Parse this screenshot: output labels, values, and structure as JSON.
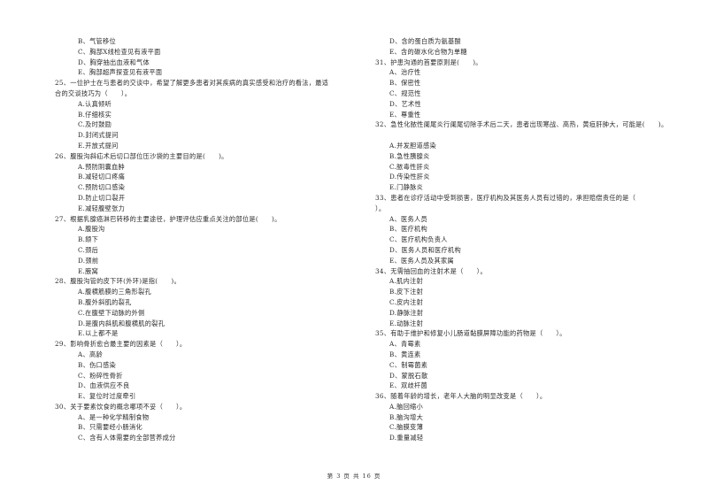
{
  "left_column": [
    {
      "type": "opt",
      "text": "B、气管移位"
    },
    {
      "type": "opt",
      "text": "C、胸部X线检查见有液平面"
    },
    {
      "type": "opt",
      "text": "D、胸穿抽出血液和气体"
    },
    {
      "type": "opt",
      "text": "E、胸部超声探查见有液平面"
    },
    {
      "type": "q",
      "text": "25、一位护士在与患者的交谈中，希望了解更多患者对其疾病的真实感受和治疗的看法，最适"
    },
    {
      "type": "cont",
      "text": "合的交谈技巧为（　　）。"
    },
    {
      "type": "opt",
      "text": "A.认真倾听"
    },
    {
      "type": "opt",
      "text": "B.仔细核实"
    },
    {
      "type": "opt",
      "text": "C.及时鼓励"
    },
    {
      "type": "opt",
      "text": "D.封闭式提问"
    },
    {
      "type": "opt",
      "text": "E.开放式提问"
    },
    {
      "type": "q",
      "text": "26、腹股沟斜疝术后切口部位压沙袋的主要目的是(　　)。"
    },
    {
      "type": "opt",
      "text": "A.预防阴囊血肿"
    },
    {
      "type": "opt",
      "text": "B.减轻切口疼痛"
    },
    {
      "type": "opt",
      "text": "C.预防切口感染"
    },
    {
      "type": "opt",
      "text": "D.防止切口裂开"
    },
    {
      "type": "opt",
      "text": "E.减轻腹壁张力"
    },
    {
      "type": "q",
      "text": "27、根据乳腺癌淋巴转移的主要途径，护理评估应重点关注的部位是(　　)。"
    },
    {
      "type": "opt",
      "text": "A.腹股沟"
    },
    {
      "type": "opt",
      "text": "B.颌下"
    },
    {
      "type": "opt",
      "text": "C.颈后"
    },
    {
      "type": "opt",
      "text": "D.颈前"
    },
    {
      "type": "opt",
      "text": "E.腋窝"
    },
    {
      "type": "q",
      "text": "28、腹股沟管的皮下环(外环)是指(　　)。"
    },
    {
      "type": "opt",
      "text": "A.腹横筋膜的三角形裂孔"
    },
    {
      "type": "opt",
      "text": "B.腹外斜肌的裂孔"
    },
    {
      "type": "opt",
      "text": "C.在腹壁下动脉的外侧"
    },
    {
      "type": "opt",
      "text": "D.是腹内斜肌和腹横肌的裂孔"
    },
    {
      "type": "opt",
      "text": "E.以上都不是"
    },
    {
      "type": "q",
      "text": "29、影响骨折愈合最主要的因素是（　　）。"
    },
    {
      "type": "opt",
      "text": "A、高龄"
    },
    {
      "type": "opt",
      "text": "B、伤口感染"
    },
    {
      "type": "opt",
      "text": "C、粉碎性骨折"
    },
    {
      "type": "opt",
      "text": "D、血液供应不良"
    },
    {
      "type": "opt",
      "text": "E、复位时过度牵引"
    },
    {
      "type": "q",
      "text": "30、关于要素饮食的概念哪项不妥（　　）。"
    },
    {
      "type": "opt",
      "text": "A、是一种化学精制食物"
    },
    {
      "type": "opt",
      "text": "B、只需要经小肠消化"
    },
    {
      "type": "opt",
      "text": "C、含有人体需要的全部营养成分"
    }
  ],
  "right_column": [
    {
      "type": "opt",
      "text": "D、含的蛋白质为氨基酸"
    },
    {
      "type": "opt",
      "text": "E、含的碳水化合物为单糖"
    },
    {
      "type": "q",
      "text": "31、护患沟通的首要原则是(　　)。"
    },
    {
      "type": "opt",
      "text": "A、治疗性"
    },
    {
      "type": "opt",
      "text": "B、保密性"
    },
    {
      "type": "opt",
      "text": "C、规范性"
    },
    {
      "type": "opt",
      "text": "D、艺术性"
    },
    {
      "type": "opt",
      "text": "E、尊重性"
    },
    {
      "type": "q",
      "text": "32、急性化脓性阑尾炎行阑尾切除手术后二天，患者出现寒战、高热，黄疸肝肿大，可能是(　　)。"
    },
    {
      "type": "gap",
      "text": ""
    },
    {
      "type": "opt",
      "text": "A.并发胆道感染"
    },
    {
      "type": "opt",
      "text": "B.急性胰腺炎"
    },
    {
      "type": "opt",
      "text": "C.脓毒性肝炎"
    },
    {
      "type": "opt",
      "text": "D.传染性肝炎"
    },
    {
      "type": "opt",
      "text": "E.门静脉炎"
    },
    {
      "type": "q",
      "text": "33、患者在诊疗活动中受到损害，医疗机构及其医务人员有过错的，承担赔偿责任的是（"
    },
    {
      "type": "cont",
      "text": "）。"
    },
    {
      "type": "opt",
      "text": "A、医务人员"
    },
    {
      "type": "opt",
      "text": "B、医疗机构"
    },
    {
      "type": "opt",
      "text": "C、医疗机构负责人"
    },
    {
      "type": "opt",
      "text": "D、医务人员和医疗机构"
    },
    {
      "type": "opt",
      "text": "E、医务人员及其家属"
    },
    {
      "type": "q",
      "text": "34、无需抽回血的注射术是（　　）。"
    },
    {
      "type": "opt",
      "text": "A.肌内注射"
    },
    {
      "type": "opt",
      "text": "B.皮下注射"
    },
    {
      "type": "opt",
      "text": "C.皮内注射"
    },
    {
      "type": "opt",
      "text": "D.静脉注射"
    },
    {
      "type": "opt",
      "text": "E.动脉注射"
    },
    {
      "type": "q",
      "text": "35、有助于维护和修复小儿肠道黏膜屏障功能的药物是（　　）。"
    },
    {
      "type": "opt",
      "text": "A、青霉素"
    },
    {
      "type": "opt",
      "text": "B、黄连素"
    },
    {
      "type": "opt",
      "text": "C、制霉菌素"
    },
    {
      "type": "opt",
      "text": "D、蒙脱石散"
    },
    {
      "type": "opt",
      "text": "E、双歧杆菌"
    },
    {
      "type": "q",
      "text": "36、随着年龄的增长，老年人大脑的明显改变是（　　）。"
    },
    {
      "type": "opt",
      "text": "A.脑回缩小"
    },
    {
      "type": "opt",
      "text": "B.脑沟增大"
    },
    {
      "type": "opt",
      "text": "C.脑膜变薄"
    },
    {
      "type": "opt",
      "text": "D.重量减轻"
    }
  ],
  "footer": {
    "page_label": "第 3 页 共 16 页"
  }
}
